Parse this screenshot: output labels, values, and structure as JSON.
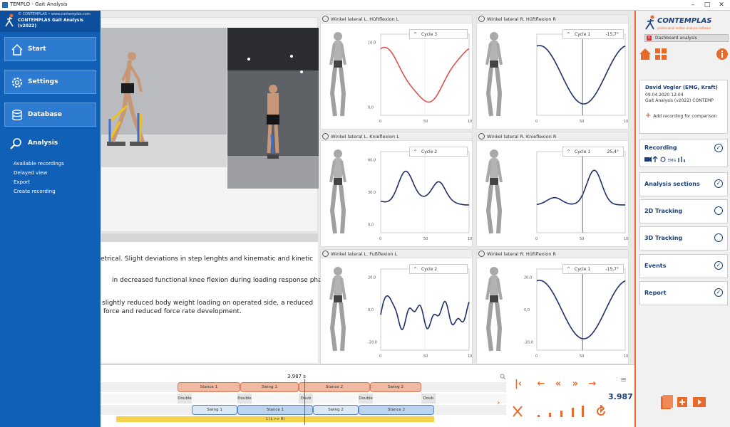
{
  "window": {
    "title": "TEMPLO - Gait Analysis",
    "minimize": "–",
    "maximize": "□",
    "close": "✕"
  },
  "brand": {
    "copyright": "© CONTEMPLAS • www.contemplas.com",
    "product": "CONTEMPLAS Gait Analysis",
    "version": "(v2022)"
  },
  "nav": {
    "start": "Start",
    "settings": "Settings",
    "database": "Database",
    "analysis": "Analysis",
    "subitems": [
      "Available recordings",
      "Delayed view",
      "Export",
      "Create recording"
    ]
  },
  "report_text": [
    "etrical. Slight deviations in step lenghts and kinematic and kinetic",
    "in decreased functional knee flexion during loading response phase on",
    "slightly reduced body weight loading on operated side, a reduced",
    "force and reduced force rate development."
  ],
  "charts": [
    {
      "title": "Winkel lateral L. Hüftflexion L",
      "cycle": "Cycle 3",
      "value": "",
      "color": "#d9534f",
      "yticks": [
        "10,0",
        "0,0"
      ],
      "xticks": [
        "0",
        "50",
        "100"
      ]
    },
    {
      "title": "Winkel lateral R. Hüftflexion R",
      "cycle": "Cycle 1",
      "value": "-15,7°",
      "color": "#1f2f6b",
      "yticks": [],
      "xticks": [
        "0",
        "50",
        "100"
      ]
    },
    {
      "title": "Winkel lateral L. Knieflexion L",
      "cycle": "Cycle 2",
      "value": "",
      "color": "#1f2f6b",
      "yticks": [
        "60,0",
        "30,0",
        "0,0"
      ],
      "xticks": [
        "0",
        "50",
        "100"
      ]
    },
    {
      "title": "Winkel lateral R. Knieflexion R",
      "cycle": "Cycle 1",
      "value": "25,4°",
      "color": "#1f2f6b",
      "yticks": [],
      "xticks": [
        "0",
        "50",
        "100"
      ]
    },
    {
      "title": "Winkel lateral L. Fußflexion L",
      "cycle": "Cycle 2",
      "value": "",
      "color": "#1f2f6b",
      "yticks": [
        "20,0",
        "0,0",
        "-20,0"
      ],
      "xticks": [
        "0",
        "50",
        "100"
      ]
    },
    {
      "title": "Winkel lateral R. Hüftflexion R",
      "cycle": "Cycle 1",
      "value": "-15,7°",
      "color": "#1f2f6b",
      "yticks": [
        "20,0",
        "0,0",
        "-20,0"
      ],
      "xticks": [
        "0",
        "50",
        "100"
      ]
    }
  ],
  "right": {
    "brand": "CONTEMPLAS",
    "tagline": "professional motion analysis software",
    "dashboard": "Dashboard analysis",
    "user": "David Vogler (EMG, Kraft)",
    "date": "09.04.2020 12:04",
    "app": "Gait Analysis (v2022) CONTEMP",
    "add": "Add recording for comparison",
    "steps": [
      {
        "label": "Recording",
        "done": "✓"
      },
      {
        "label": "Analysis sections",
        "done": "✓"
      },
      {
        "label": "2D Tracking",
        "done": ""
      },
      {
        "label": "3D Tracking",
        "done": ""
      },
      {
        "label": "Events",
        "done": "✓"
      },
      {
        "label": "Report",
        "done": "✓"
      }
    ],
    "rec_icons": [
      "cam",
      "emg",
      "EMG",
      "force"
    ]
  },
  "timeline": {
    "time_marker": "3.987 s",
    "row1": [
      {
        "label": "Stance 1",
        "kind": "red"
      },
      {
        "label": "Swing 1",
        "kind": "red"
      },
      {
        "label": "Stance 2",
        "kind": "red"
      },
      {
        "label": "Swing 2",
        "kind": "red"
      }
    ],
    "double": "Double",
    "double_short": "Doub",
    "row3": [
      {
        "label": "Swing 1",
        "kind": "pale"
      },
      {
        "label": "Stance 1",
        "kind": "blue"
      },
      {
        "label": "Swing 2",
        "kind": "pale"
      },
      {
        "label": "Stance 2",
        "kind": "blue"
      }
    ],
    "yellow": "1 (L >> R)"
  },
  "player": {
    "time": "3.987",
    "menu": "≡"
  }
}
